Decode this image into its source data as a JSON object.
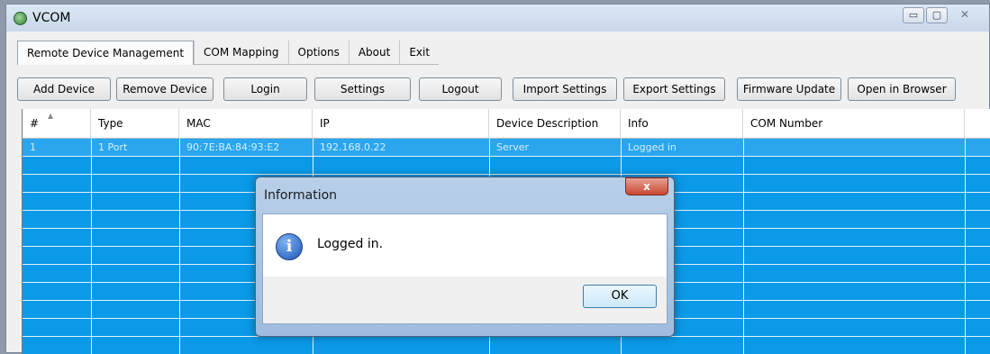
{
  "window": {
    "title": "VCOM",
    "minimize_glyph": "▭",
    "restore_glyph": "▢",
    "close_glyph": "✕"
  },
  "menu": [
    {
      "label": "Remote Device Management",
      "active": true
    },
    {
      "label": "COM Mapping",
      "active": false
    },
    {
      "label": "Options",
      "active": false
    },
    {
      "label": "About",
      "active": false
    },
    {
      "label": "Exit",
      "active": false
    }
  ],
  "toolbar": {
    "add_device": "Add Device",
    "remove_device": "Remove Device",
    "login": "Login",
    "settings": "Settings",
    "logout": "Logout",
    "import_settings": "Import Settings",
    "export_settings": "Export Settings",
    "firmware_update": "Firmware Update",
    "open_in_browser": "Open in Browser"
  },
  "table": {
    "columns": [
      "#",
      "Type",
      "MAC",
      "IP",
      "Device Description",
      "Info",
      "COM Number"
    ],
    "rows": [
      {
        "num": "1",
        "type": "1 Port",
        "mac": "90:7E:BA:84:93:E2",
        "ip": "192.168.0.22",
        "description": "Server",
        "info": "Logged in",
        "com": ""
      }
    ]
  },
  "dialog": {
    "title": "Information",
    "message": "Logged in.",
    "ok_label": "OK",
    "close_glyph": "x"
  },
  "colors": {
    "grid_background": "#0a9ae8",
    "selected_row": "#2aa6ee"
  }
}
